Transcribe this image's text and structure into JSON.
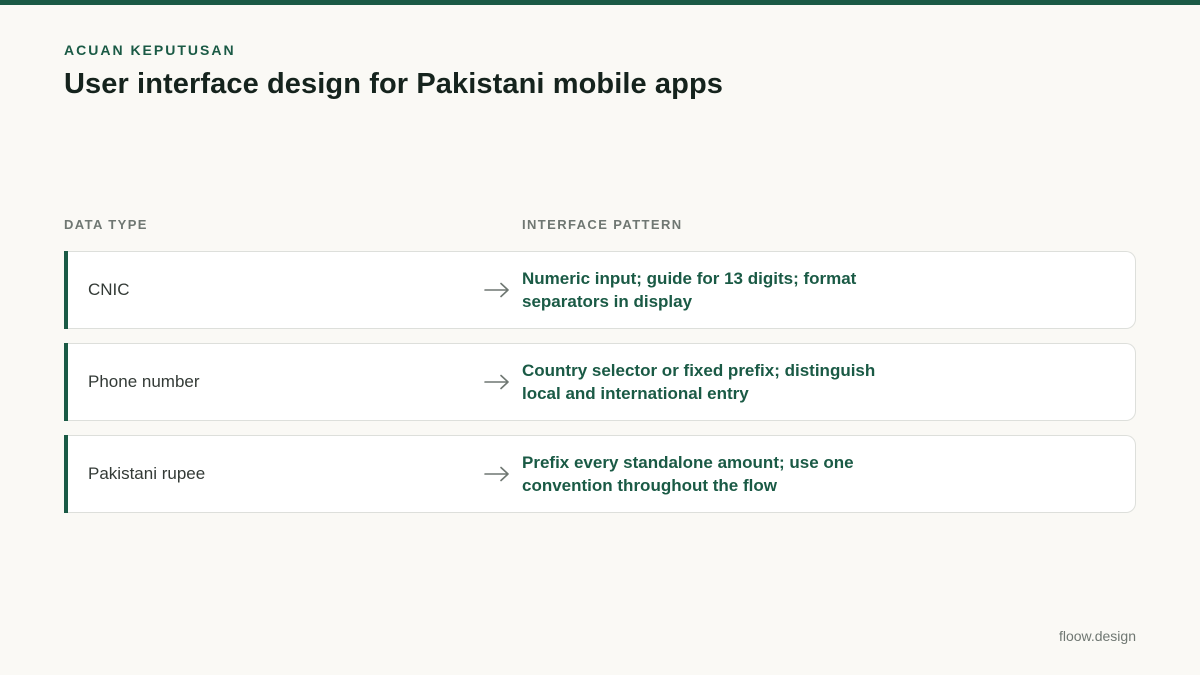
{
  "header": {
    "eyebrow": "ACUAN KEPUTUSAN",
    "title": "User interface design for Pakistani mobile apps"
  },
  "columns": {
    "left": "DATA TYPE",
    "right": "INTERFACE PATTERN"
  },
  "rows": [
    {
      "type": "CNIC",
      "pattern": "Numeric input; guide for 13 digits; format separators in display"
    },
    {
      "type": "Phone number",
      "pattern": "Country selector or fixed prefix; distinguish local and international entry"
    },
    {
      "type": "Pakistani rupee",
      "pattern": "Prefix every standalone amount; use one convention throughout the flow"
    }
  ],
  "footer": {
    "brand": "floow.design"
  },
  "icons": {
    "arrow": "arrow-right-icon"
  },
  "colors": {
    "accent": "#1a5a45",
    "background": "#faf9f5"
  }
}
